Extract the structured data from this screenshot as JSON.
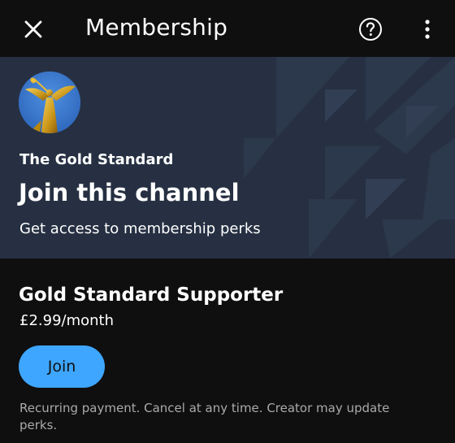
{
  "header": {
    "title": "Membership",
    "close_icon": "close-icon",
    "help_icon": "help-icon",
    "more_icon": "more-vert-icon"
  },
  "banner": {
    "channel_name": "The Gold Standard",
    "heading": "Join this channel",
    "subheading": "Get access to membership perks",
    "background_color": "#263042"
  },
  "tier": {
    "name": "Gold Standard Supporter",
    "price": "£2.99/month",
    "join_label": "Join",
    "join_color": "#3ea6ff",
    "disclaimer": "Recurring payment. Cancel at any time. Creator may update perks."
  }
}
